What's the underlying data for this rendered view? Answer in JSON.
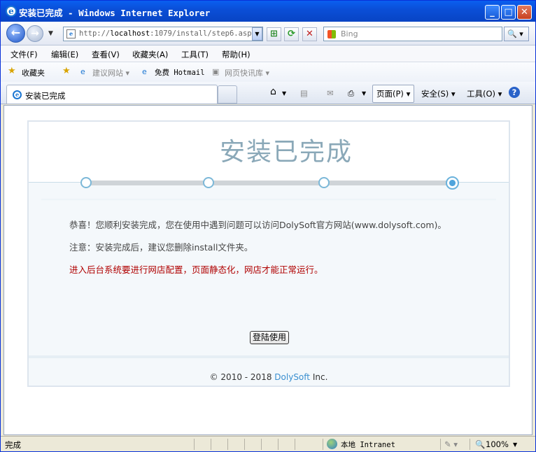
{
  "window": {
    "title": "安装已完成 - Windows Internet Explorer",
    "minimize": "_",
    "maximize": "□",
    "close": "✕"
  },
  "nav": {
    "back": "←",
    "forward": "→",
    "address_prefix": "http://",
    "address_host": "localhost",
    "address_rest": ":1079/install/step6.aspx",
    "search_placeholder": "Bing",
    "search_icon": "🔍"
  },
  "menu": [
    "文件(F)",
    "编辑(E)",
    "查看(V)",
    "收藏夹(A)",
    "工具(T)",
    "帮助(H)"
  ],
  "favorites": {
    "label": "收藏夹",
    "items": [
      "建议网站 ▾",
      "免费 Hotmail",
      "网页快讯库 ▾"
    ]
  },
  "tab": {
    "title": "安装已完成"
  },
  "commands": {
    "page": "页面(P) ▾",
    "safety": "安全(S) ▾",
    "tools": "工具(O) ▾",
    "help": "?"
  },
  "page": {
    "title": "安装已完成",
    "steps": 4,
    "current_step": 4,
    "line1": "恭喜！您顺利安装完成，您在使用中遇到问题可以访问DolySoft官方网站(www.dolysoft.com)。",
    "line2": "注意：安装完成后，建议您删除install文件夹。",
    "line3": "进入后台系统要进行网店配置，页面静态化，网店才能正常运行。",
    "button": "登陆使用",
    "footer_prefix": "© 2010 - 2018",
    "footer_brand": "DolySoft",
    "footer_suffix": "Inc."
  },
  "status": {
    "text": "完成",
    "zone": "本地 Intranet",
    "zoom": "100%"
  },
  "colors": {
    "accent": "#3a8fd0",
    "warning_text": "#b00000",
    "title_text": "#8aa8b8"
  }
}
